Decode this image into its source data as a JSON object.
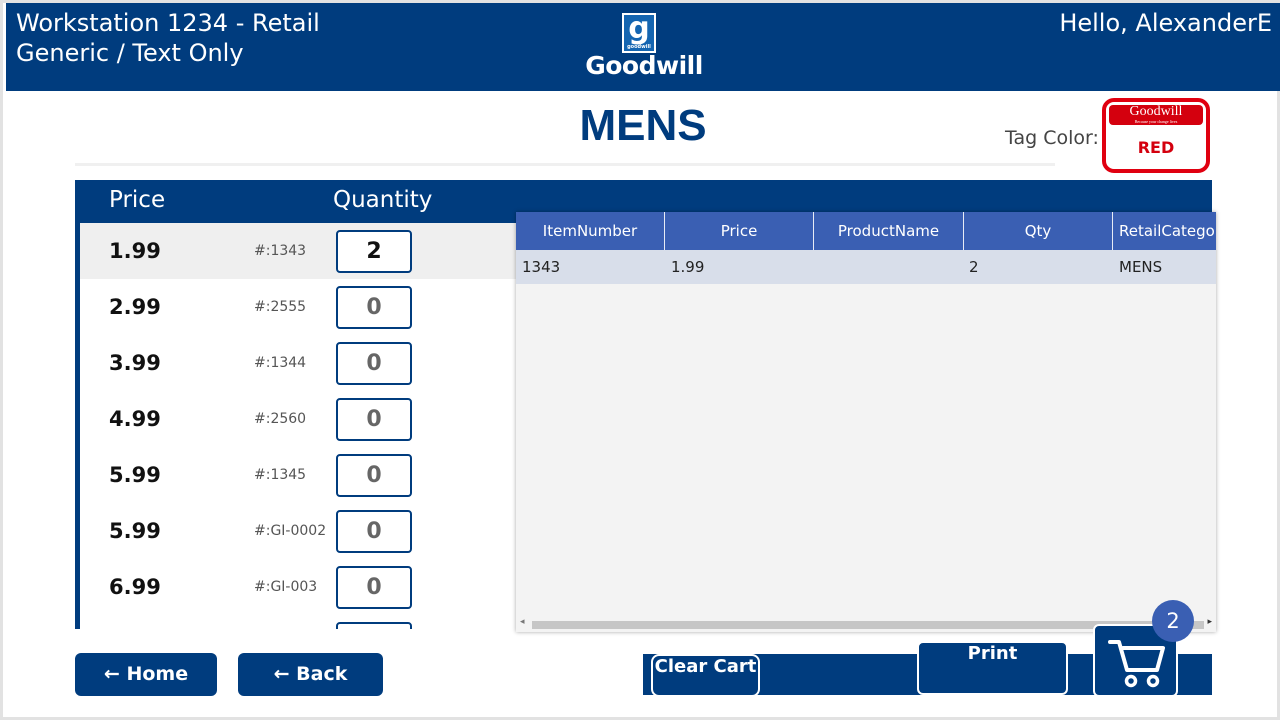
{
  "header": {
    "workstation": "Workstation 1234 - Retail",
    "mode": "Generic / Text Only",
    "greeting": "Hello, AlexanderE",
    "logo_text": "Goodwill",
    "logo_glyph": "g",
    "logo_small": "goodwill"
  },
  "title": "MENS",
  "tag": {
    "label": "Tag Color:",
    "brand": "Goodwill",
    "brand_tagline": "Because your change lives",
    "color_name": "RED",
    "color_hex": "#d4000e"
  },
  "columns": {
    "price": "Price",
    "quantity": "Quantity"
  },
  "price_items": [
    {
      "price": "1.99",
      "number": "#:1343",
      "qty": "2"
    },
    {
      "price": "2.99",
      "number": "#:2555",
      "qty": "0"
    },
    {
      "price": "3.99",
      "number": "#:1344",
      "qty": "0"
    },
    {
      "price": "4.99",
      "number": "#:2560",
      "qty": "0"
    },
    {
      "price": "5.99",
      "number": "#:1345",
      "qty": "0"
    },
    {
      "price": "5.99",
      "number": "#:GI-0002",
      "qty": "0"
    },
    {
      "price": "6.99",
      "number": "#:GI-003",
      "qty": "0"
    }
  ],
  "grid": {
    "headers": [
      "ItemNumber",
      "Price",
      "ProductName",
      "Qty",
      "RetailCategory"
    ],
    "rows": [
      [
        "1343",
        "1.99",
        "",
        "2",
        "MENS"
      ]
    ]
  },
  "buttons": {
    "home": "← Home",
    "back": "← Back",
    "clear_cart": "Clear Cart",
    "print": "Print"
  },
  "cart": {
    "count": "2",
    "icon": "cart-icon"
  },
  "colors": {
    "primary": "#003c7e",
    "grid_header": "#3a5fb3",
    "grid_row_selected": "#d8deea"
  }
}
